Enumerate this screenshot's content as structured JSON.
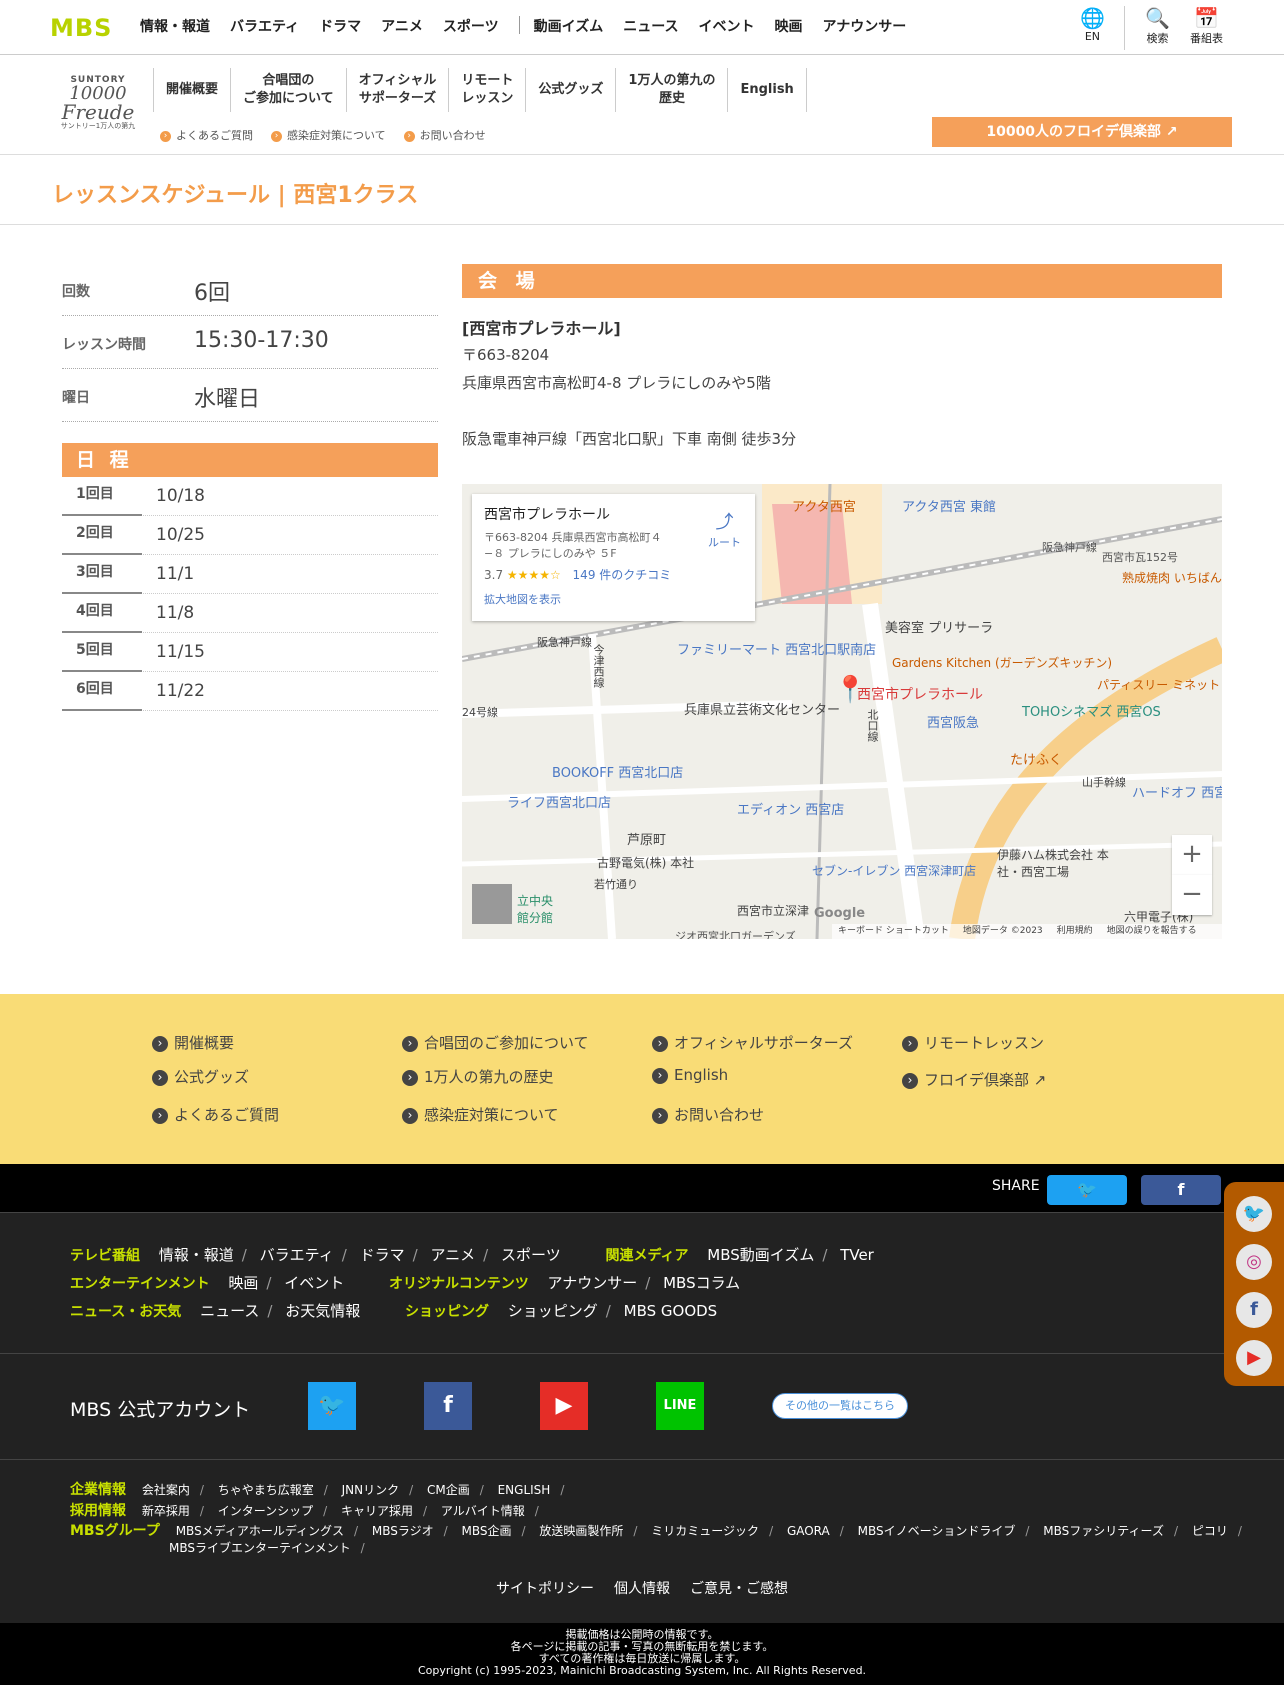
{
  "header": {
    "logo": "MBS",
    "menu": [
      "情報・報道",
      "バラエティ",
      "ドラマ",
      "アニメ",
      "スポーツ"
    ],
    "menu2": [
      "動画イズム",
      "ニュース",
      "イベント",
      "映画",
      "アナウンサー"
    ],
    "lang_label": "EN",
    "search_label": "検索",
    "schedule_label": "番組表"
  },
  "subheader": {
    "logo_brand": "SUNTORY",
    "logo_number": "10000",
    "logo_word": "Freude",
    "logo_caption": "サントリー1万人の第九",
    "menu": [
      "開催概要",
      "合唱団の\nご参加について",
      "オフィシャル\nサポーターズ",
      "リモート\nレッスン",
      "公式グッズ",
      "1万人の第九の\n歴史",
      "English"
    ],
    "links": [
      "よくあるご質問",
      "感染症対策について",
      "お問い合わせ"
    ],
    "club_button": "10000人のフロイデ倶楽部 ↗"
  },
  "page_title": "レッスンスケジュール | 西宮1クラス",
  "info": [
    {
      "key": "回数",
      "value": "6回"
    },
    {
      "key": "レッスン時間",
      "value": "15:30-17:30"
    },
    {
      "key": "曜日",
      "value": "水曜日"
    }
  ],
  "schedule": {
    "heading": "日 程",
    "rows": [
      {
        "n": "1回目",
        "d": "10/18"
      },
      {
        "n": "2回目",
        "d": "10/25"
      },
      {
        "n": "3回目",
        "d": "11/1"
      },
      {
        "n": "4回目",
        "d": "11/8"
      },
      {
        "n": "5回目",
        "d": "11/15"
      },
      {
        "n": "6回目",
        "d": "11/22"
      }
    ]
  },
  "venue": {
    "heading": "会 場",
    "name": "[西宮市プレラホール]",
    "zip": "〒663-8204",
    "address": "兵庫県西宮市高松町4-8 プレラにしのみや5階",
    "access": "阪急電車神戸線「西宮北口駅」下車 南側 徒歩3分"
  },
  "map": {
    "card_title": "西宮市プレラホール",
    "card_address": "〒663-8204 兵庫県西宮市高松町４−８ プレラにしのみや ５F",
    "rating": "3.7",
    "stars": "★★★★☆",
    "reviews": "149 件のクチコミ",
    "enlarge": "拡大地図を表示",
    "route": "ルート",
    "pin_label": "西宮市プレラホール",
    "labels": [
      "アクタ西宮",
      "アクタ西宮 東館",
      "阪急神戸線",
      "西宮市瓦152号",
      "熟成焼肉 いちばん 西宮店",
      "美容室 プリサーラ",
      "ファミリーマート 西宮北口駅南店",
      "Gardens Kitchen (ガーデンズキッチン)",
      "パティスリー ミネット",
      "兵庫県立芸術文化センター",
      "TOHOシネマズ 西宮OS",
      "西宮阪急",
      "たけふく",
      "BOOKOFF 西宮北口店",
      "ライフ西宮北口店",
      "エディオン 西宮店",
      "山手幹線",
      "ハードオフ 西宮",
      "芦原町",
      "古野電気(株) 本社",
      "セブン-イレブン 西宮深津町店",
      "伊藤ハム株式会社 本社・西宮工場",
      "西宮市立深津",
      "六甲電子(株)",
      "24号線",
      "今津西線",
      "北口線",
      "阪急神戸線",
      "若竹通り",
      "立中央館分館",
      "ジオ西宮北口ガーデンズ"
    ],
    "zoom_in": "+",
    "zoom_out": "−",
    "footer": [
      "キーボード ショートカット",
      "地図データ ©2023",
      "利用規約",
      "地図の誤りを報告する"
    ],
    "google": "Google"
  },
  "yellow_footer": {
    "links": [
      "開催概要",
      "合唱団のご参加について",
      "オフィシャルサポーターズ",
      "リモートレッスン",
      "公式グッズ",
      "1万人の第九の歴史",
      "English",
      "フロイデ倶楽部 ↗",
      "よくあるご質問",
      "感染症対策について",
      "お問い合わせ"
    ]
  },
  "share": {
    "label": "SHARE",
    "twitter": "🐦",
    "facebook": "f"
  },
  "footer": {
    "tv": {
      "cat": "テレビ番組",
      "items": [
        "情報・報道",
        "バラエティ",
        "ドラマ",
        "アニメ",
        "スポーツ"
      ]
    },
    "media": {
      "cat": "関連メディア",
      "items": [
        "MBS動画イズム",
        "TVer"
      ]
    },
    "ent": {
      "cat": "エンターテインメント",
      "items": [
        "映画",
        "イベント"
      ]
    },
    "orig": {
      "cat": "オリジナルコンテンツ",
      "items": [
        "アナウンサー",
        "MBSコラム"
      ]
    },
    "news": {
      "cat": "ニュース・お天気",
      "items": [
        "ニュース",
        "お天気情報"
      ]
    },
    "shop": {
      "cat": "ショッピング",
      "items": [
        "ショッピング",
        "MBS GOODS"
      ]
    },
    "accounts_label": "MBS 公式アカウント",
    "accounts": [
      "twitter-icon",
      "facebook-icon",
      "youtube-icon",
      "line-icon"
    ],
    "account_glyphs": [
      "🐦",
      "f",
      "▶",
      "LINE"
    ],
    "more_accounts": "その他の一覧はこちら",
    "corp": {
      "cat": "企業情報",
      "items": [
        "会社案内",
        "ちゃやまち広報室",
        "JNNリンク",
        "CM企画",
        "ENGLISH"
      ]
    },
    "recruit": {
      "cat": "採用情報",
      "items": [
        "新卒採用",
        "インターンシップ",
        "キャリア採用",
        "アルバイト情報"
      ]
    },
    "group": {
      "cat": "MBSグループ",
      "items": [
        "MBSメディアホールディングス",
        "MBSラジオ",
        "MBS企画",
        "放送映画製作所",
        "ミリカミュージック",
        "GAORA",
        "MBSイノベーションドライブ",
        "MBSファシリティーズ",
        "ピコリ"
      ],
      "items2": [
        "MBSライブエンターテインメント"
      ]
    },
    "policy": [
      "サイトポリシー",
      "個人情報",
      "ご意見・ご感想"
    ],
    "notice1": "掲載価格は公開時の情報です。",
    "notice2": "各ページに掲載の記事・写真の無断転用を禁じます。",
    "notice3": "すべての著作権は毎日放送に帰属します。",
    "copyright": "Copyright (c) 1995-2023, Mainichi Broadcasting System, Inc. All Rights Reserved."
  },
  "social_float": [
    "twitter-icon",
    "instagram-icon",
    "facebook-icon",
    "youtube-icon"
  ],
  "social_float_glyphs": [
    "🐦",
    "◎",
    "f",
    "▶"
  ],
  "colors": {
    "accent": "#f5a05a",
    "title": "#f39c4a",
    "footer_yellow": "#f9dc76",
    "category_green": "#c8e000"
  }
}
